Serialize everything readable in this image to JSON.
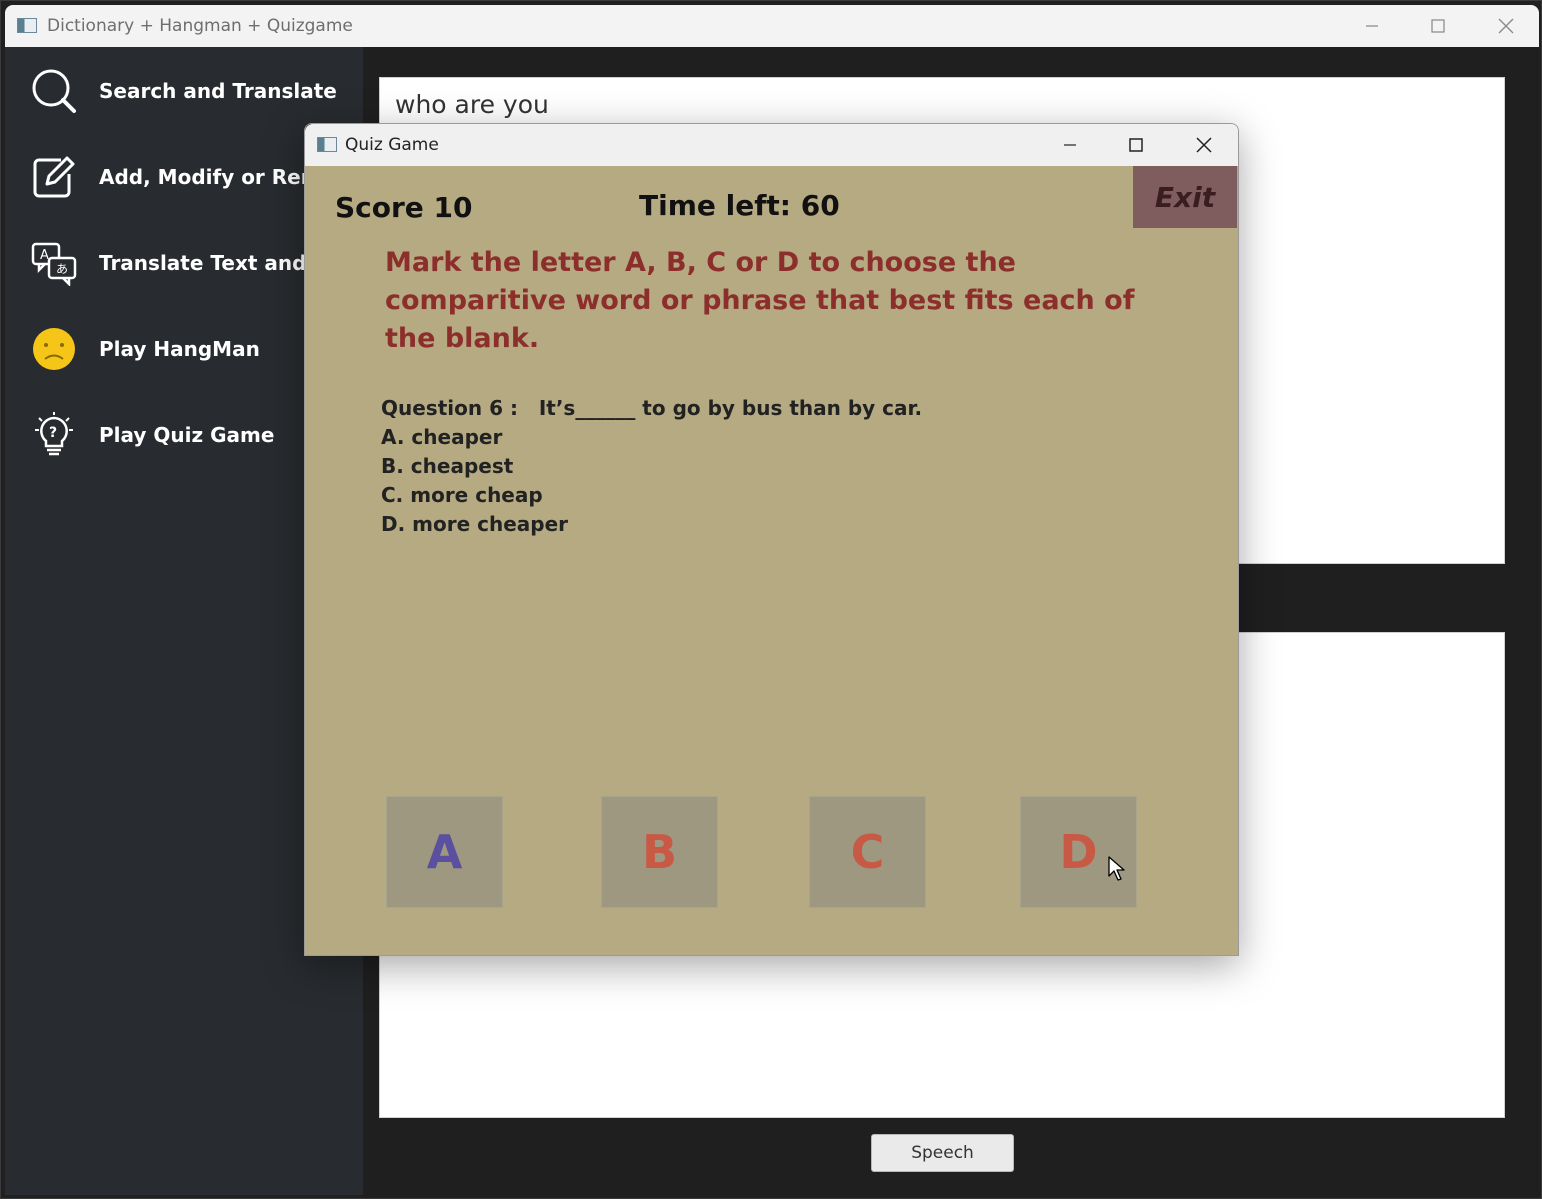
{
  "main_window": {
    "title": "Dictionary + Hangman + Quizgame"
  },
  "sidebar": {
    "items": [
      {
        "label": "Search and Translate",
        "icon": "search-icon"
      },
      {
        "label": "Add, Modify or Remove",
        "icon": "edit-icon"
      },
      {
        "label": "Translate Text and Speech",
        "icon": "translate-icon"
      },
      {
        "label": "Play HangMan",
        "icon": "sad-face-icon"
      },
      {
        "label": "Play Quiz Game",
        "icon": "lightbulb-question-icon"
      }
    ]
  },
  "search": {
    "value": "who are you"
  },
  "speech_button": {
    "label": "Speech"
  },
  "quiz_window": {
    "title": "Quiz Game",
    "score_text": "Score 10",
    "time_text": "Time left: 60",
    "exit_label": "Exit",
    "instruction": "Mark the letter A, B, C or D to choose the comparitive word or phrase that best fits each of the blank.",
    "question_line": "Question 6 :   It’s______ to go by bus than by car.",
    "options": [
      "A. cheaper",
      "B. cheapest",
      "C. more cheap",
      "D. more cheaper"
    ],
    "answer_buttons": [
      {
        "label": "A",
        "color": "#5b4fa0"
      },
      {
        "label": "B",
        "color": "#c85a45"
      },
      {
        "label": "C",
        "color": "#c85a45"
      },
      {
        "label": "D",
        "color": "#c85a45"
      }
    ]
  },
  "colors": {
    "quiz_background": "#b5aa82",
    "instruction_text": "#8c2f2c",
    "exit_button": "#7f5c5e",
    "sidebar": "#282b2f"
  }
}
